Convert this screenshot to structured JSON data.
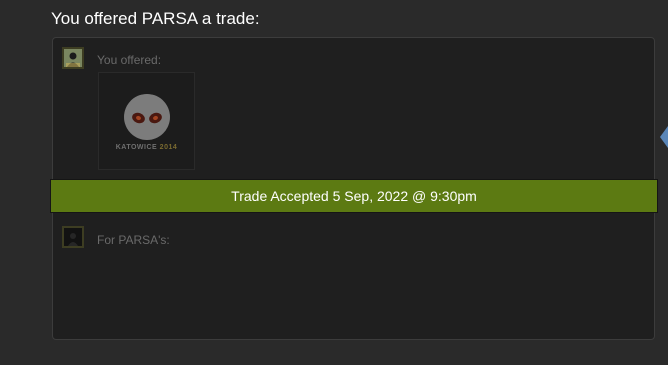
{
  "offer": {
    "heading": "You offered PARSA a trade:",
    "you_label": "You offered:",
    "partner_label": "For PARSA's:",
    "status": "Trade Accepted 5 Sep, 2022 @ 9:30pm"
  },
  "item": {
    "icon": "dignitas-sticker-icon",
    "caption_main": "KATOWICE",
    "caption_year": "2014"
  },
  "colors": {
    "accepted_bar": "#5c7a12",
    "background": "#2a2a2a",
    "panel": "#1f1f1f"
  }
}
